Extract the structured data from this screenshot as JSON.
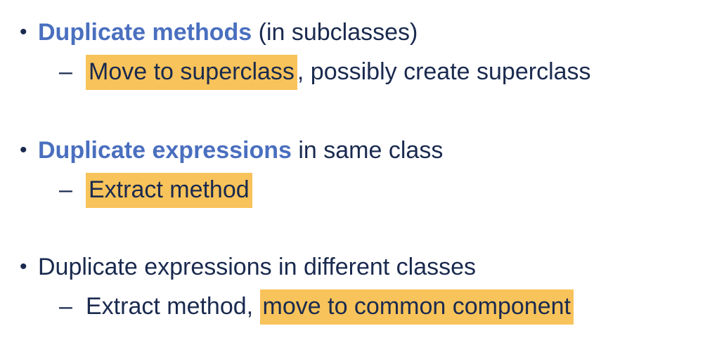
{
  "items": [
    {
      "bullet": "•",
      "emphasis": "Duplicate methods",
      "rest": " (in subclasses)",
      "sub": {
        "dash": "–",
        "highlight": "Move to superclass",
        "rest": ", possibly create superclass"
      }
    },
    {
      "bullet": "•",
      "emphasis": "Duplicate expressions",
      "rest": " in same class",
      "sub": {
        "dash": "–",
        "highlight": "Extract method"
      }
    },
    {
      "bullet": "•",
      "text": "Duplicate expressions in different classes",
      "sub": {
        "dash": "–",
        "prefix": "Extract method, ",
        "highlight": "move to common component"
      }
    }
  ],
  "colors": {
    "emphasis": "#4a6fbf",
    "text": "#1a2a4f",
    "highlight": "#f8c35a"
  }
}
